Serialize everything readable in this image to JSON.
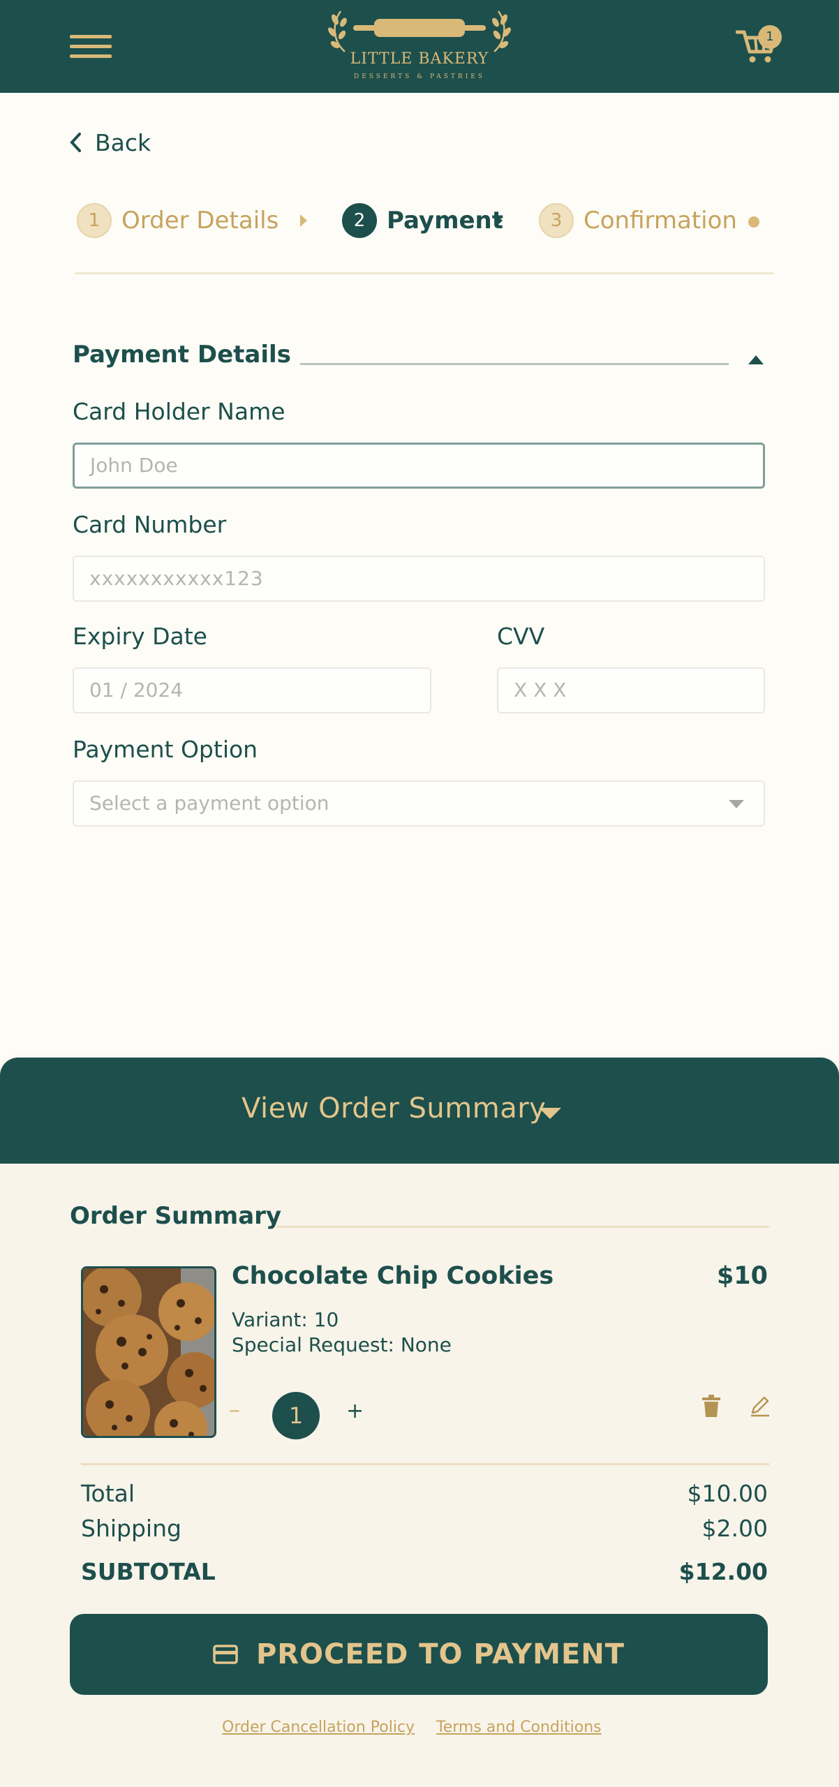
{
  "header": {
    "brand_name": "LITTLE BAKERY",
    "brand_tagline": "DESSERTS & PASTRIES",
    "cart_count": "1",
    "colors": {
      "primary": "#1d4f4c",
      "accent": "#d9b978",
      "background": "#fdfcf6"
    }
  },
  "nav": {
    "back_label": "Back"
  },
  "stepper": {
    "steps": [
      {
        "number": "1",
        "label": "Order Details",
        "state": "done"
      },
      {
        "number": "2",
        "label": "Payment",
        "state": "active"
      },
      {
        "number": "3",
        "label": "Confirmation",
        "state": "upcoming"
      }
    ]
  },
  "payment": {
    "title": "Payment Details",
    "card_holder": {
      "label": "Card Holder Name",
      "placeholder": "John Doe"
    },
    "card_number": {
      "label": "Card Number",
      "placeholder": "xxxxxxxxxxx123"
    },
    "expiry": {
      "label": "Expiry Date",
      "placeholder": "01 / 2024"
    },
    "cvv": {
      "label": "CVV",
      "placeholder": "X X X"
    },
    "option": {
      "label": "Payment Option",
      "placeholder": "Select a payment option"
    }
  },
  "summary_toggle": {
    "label": "View Order Summary"
  },
  "order_summary": {
    "title": "Order Summary",
    "items": [
      {
        "name": "Chocolate Chip Cookies",
        "price": "$10",
        "variant": "Variant: 10",
        "special_request": "Special Request: None",
        "quantity": "1",
        "minus": "–",
        "plus": "+"
      }
    ],
    "totals": {
      "total_label": "Total",
      "total_value": "$10.00",
      "shipping_label": "Shipping",
      "shipping_value": "$2.00",
      "subtotal_label": "SUBTOTAL",
      "subtotal_value": "$12.00"
    },
    "proceed_label": "PROCEED TO PAYMENT"
  },
  "footer": {
    "cancellation_link": "Order Cancellation Policy",
    "terms_link": "Terms and Conditions"
  }
}
